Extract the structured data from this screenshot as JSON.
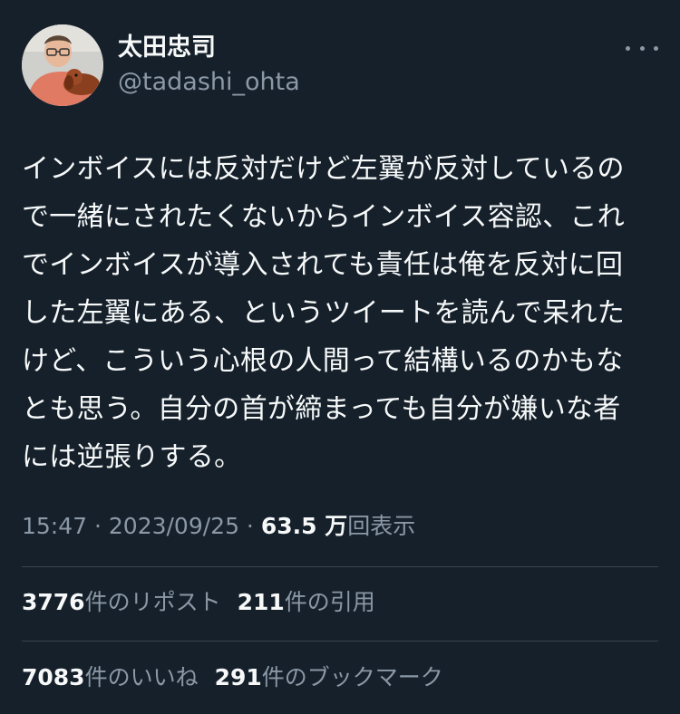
{
  "author": {
    "name": "太田忠司",
    "handle": "@tadashi_ohta"
  },
  "tweet": {
    "lines": [
      "インボイスには反対だけど左翼が反対しているの",
      "で一緒にされたくないからインボイス容認、これ",
      "でインボイスが導入されても責任は俺を反対に回",
      "した左翼にある、というツイートを読んで呆れた",
      "けど、こういう心根の人間って結構いるのかもな",
      "とも思う。自分の首が締まっても自分が嫌いな者",
      "には逆張りする。"
    ]
  },
  "meta": {
    "time": "15:47",
    "sep1": " · ",
    "date": "2023/09/25",
    "sep2": " · ",
    "views_count": "63.5 万",
    "views_label": "回表示"
  },
  "stats": {
    "reposts_count": "3776",
    "reposts_label": "件のリポスト",
    "quotes_count": "211",
    "quotes_label": "件の引用",
    "likes_count": "7083",
    "likes_label": "件のいいね",
    "bookmarks_count": "291",
    "bookmarks_label": "件のブックマーク"
  },
  "icons": {
    "more": "more-horizontal-icon"
  },
  "colors": {
    "background": "#15202b",
    "text": "#f7f9f9",
    "secondary": "#8b98a5",
    "divider": "#38444d"
  }
}
